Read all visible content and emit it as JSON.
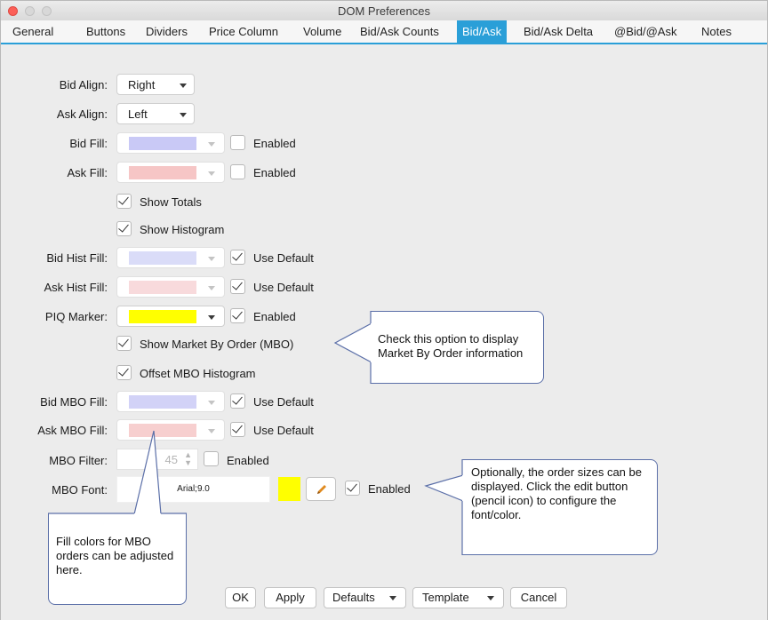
{
  "window": {
    "title": "DOM Preferences"
  },
  "tabs": [
    {
      "label": "General",
      "active": false
    },
    {
      "label": "Buttons",
      "active": false
    },
    {
      "label": "Dividers",
      "active": false
    },
    {
      "label": "Price Column",
      "active": false
    },
    {
      "label": "Volume",
      "active": false
    },
    {
      "label": "Bid/Ask Counts",
      "active": false
    },
    {
      "label": "Bid/Ask",
      "active": true
    },
    {
      "label": "Bid/Ask Delta",
      "active": false
    },
    {
      "label": "@Bid/@Ask",
      "active": false
    },
    {
      "label": "Notes",
      "active": false
    }
  ],
  "form": {
    "bid_align": {
      "label": "Bid Align:",
      "value": "Right"
    },
    "ask_align": {
      "label": "Ask Align:",
      "value": "Left"
    },
    "bid_fill": {
      "label": "Bid Fill:",
      "color": "#c9c9f6",
      "check_label": "Enabled",
      "checked": false
    },
    "ask_fill": {
      "label": "Ask Fill:",
      "color": "#f6c6c6",
      "check_label": "Enabled",
      "checked": false
    },
    "show_totals": {
      "label": "Show Totals",
      "checked": true
    },
    "show_histogram": {
      "label": "Show Histogram",
      "checked": true
    },
    "bid_hist_fill": {
      "label": "Bid Hist Fill:",
      "color": "#cdd0f5",
      "check_label": "Use Default",
      "checked": true
    },
    "ask_hist_fill": {
      "label": "Ask Hist Fill:",
      "color": "#f5cdd0",
      "check_label": "Use Default",
      "checked": true
    },
    "piq_marker": {
      "label": "PIQ Marker:",
      "color": "#ffff00",
      "check_label": "Enabled",
      "checked": true
    },
    "show_mbo": {
      "label": "Show Market By Order (MBO)",
      "checked": true
    },
    "offset_mbo": {
      "label": "Offset MBO Histogram",
      "checked": true
    },
    "bid_mbo_fill": {
      "label": "Bid MBO Fill:",
      "color": "#d2d2f7",
      "check_label": "Use Default",
      "checked": true
    },
    "ask_mbo_fill": {
      "label": "Ask MBO Fill:",
      "color": "#f7cfcf",
      "check_label": "Use Default",
      "checked": true
    },
    "mbo_filter": {
      "label": "MBO Filter:",
      "value": "45",
      "check_label": "Enabled",
      "checked": false
    },
    "mbo_font": {
      "label": "MBO Font:",
      "value": "Arial;9.0",
      "color": "#ffff00",
      "check_label": "Enabled",
      "checked": true
    }
  },
  "callouts": {
    "mbo": "Check this option to display Market By Order information",
    "order_sizes": "Optionally, the order sizes can be displayed.  Click the edit button (pencil icon) to configure the font/color.",
    "fill_colors": "Fill colors for MBO orders can be adjusted here."
  },
  "buttons": {
    "ok": "OK",
    "apply": "Apply",
    "defaults": "Defaults",
    "template": "Template",
    "cancel": "Cancel"
  },
  "colors": {
    "accent": "#2a9fd8",
    "close": "#fc5f57",
    "minimize": "#d4d4d4",
    "zoom": "#d4d4d4",
    "pencil": "#e08a1e"
  }
}
